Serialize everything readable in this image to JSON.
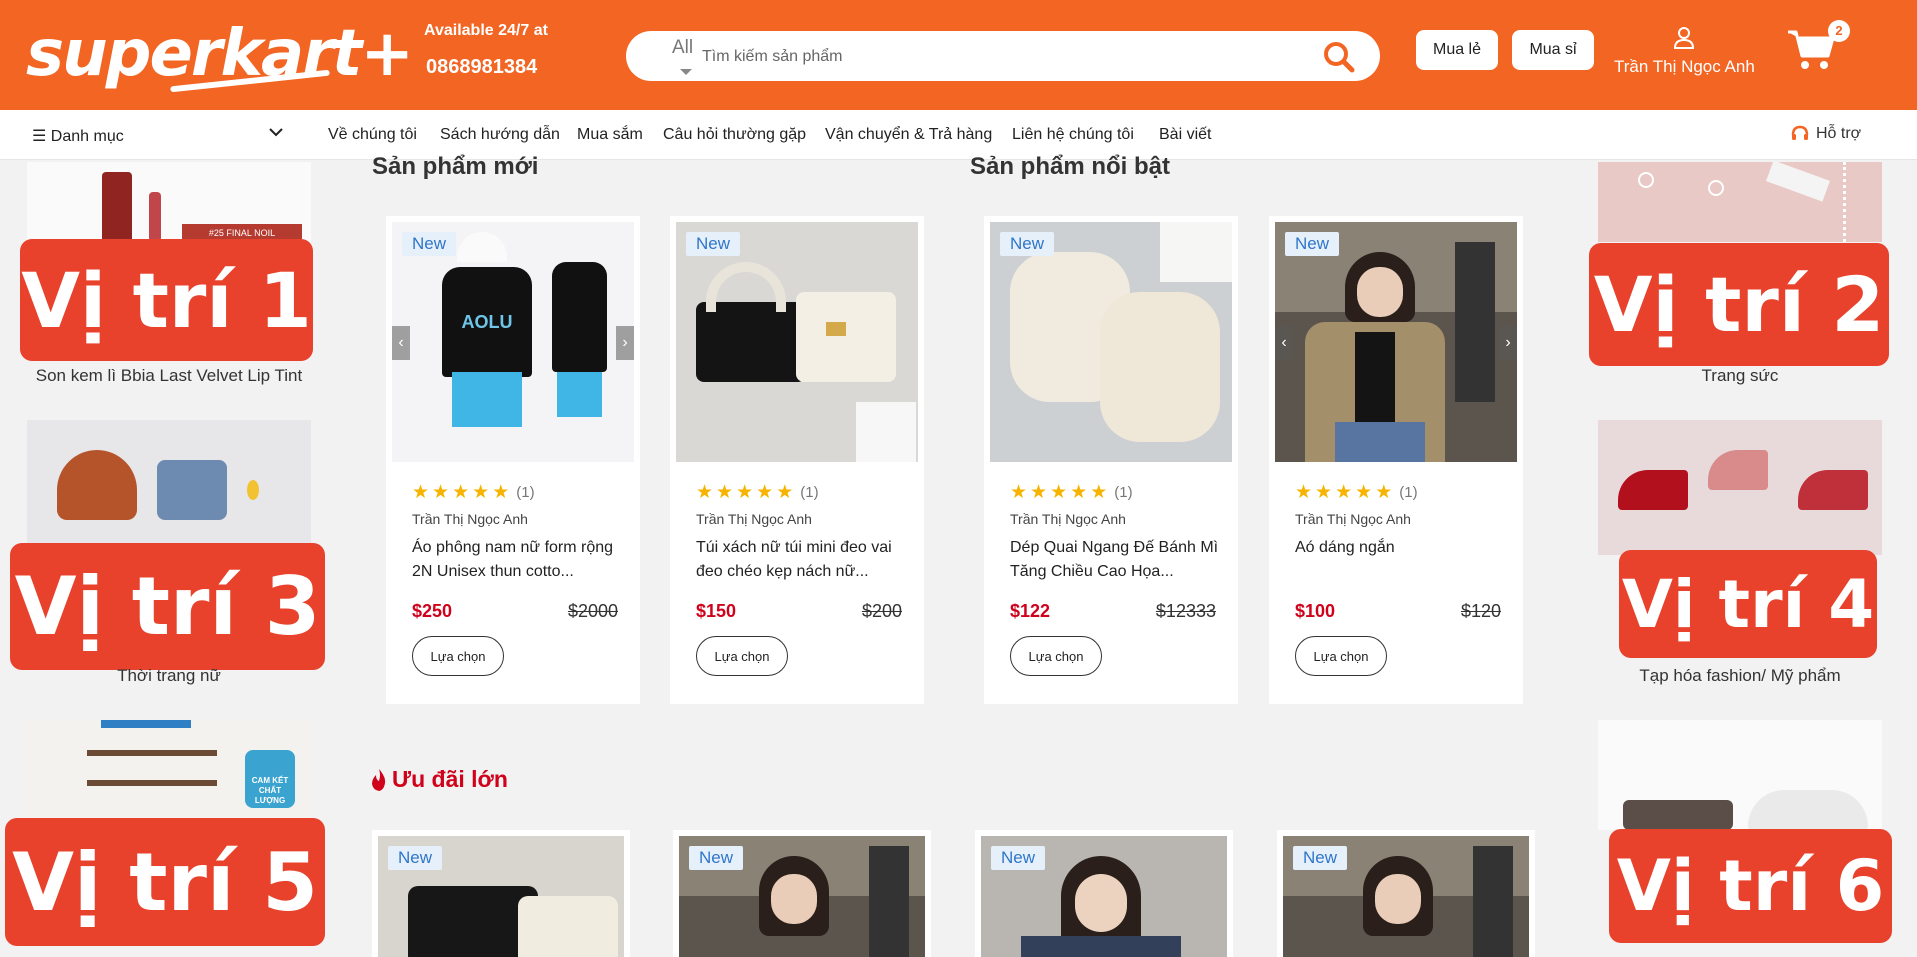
{
  "header": {
    "logo_text": "superkart+",
    "available_text": "Available 24/7 at",
    "phone": "0868981384",
    "search": {
      "category": "All",
      "placeholder": "Tìm kiếm sản phẩm"
    },
    "buttons": {
      "retail": "Mua lẻ",
      "wholesale": "Mua sỉ"
    },
    "user_name": "Trần Thị Ngọc Anh",
    "cart_count": "2"
  },
  "nav": {
    "category_label": "Danh mục",
    "items": [
      "Về chúng tôi",
      "Sách hướng dẫn",
      "Mua sắm",
      "Câu hỏi thường gặp",
      "Vận chuyển & Trả hàng",
      "Liên hệ chúng tôi",
      "Bài viết"
    ],
    "support": "Hỗ trợ"
  },
  "banners": [
    {
      "tag": "Vị trí 1",
      "label": "Son kem lì Bbia Last Velvet Lip Tint"
    },
    {
      "tag": "Vị trí 2",
      "label": "Trang sức"
    },
    {
      "tag": "Vị trí 3",
      "label": "Thời trang nữ"
    },
    {
      "tag": "Vị trí 4",
      "label": "Tạp hóa fashion/ Mỹ phẩm"
    },
    {
      "tag": "Vị trí 5",
      "label": ""
    },
    {
      "tag": "Vị trí 6",
      "label": ""
    }
  ],
  "banner_small_texts": {
    "lip_box": "#25 FINAL NOIL",
    "guarantee": "CAM KẾT CHẤT LƯỢNG"
  },
  "sections": {
    "new_title": "Sản phẩm mới",
    "featured_title": "Sản phẩm nổi bật",
    "deals_title": "Ưu đãi lớn"
  },
  "products": [
    {
      "badge": "New",
      "rating": "(1)",
      "seller": "Trần Thị Ngọc Anh",
      "name": "Áo phông nam nữ form rộng 2N Unisex thun cotto...",
      "price": "$250",
      "old_price": "$2000",
      "button": "Lựa chọn"
    },
    {
      "badge": "New",
      "rating": "(1)",
      "seller": "Trần Thị Ngọc Anh",
      "name": "Túi xách nữ túi mini đeo vai đeo chéo kẹp nách nữ...",
      "price": "$150",
      "old_price": "$200",
      "button": "Lựa chọn"
    },
    {
      "badge": "New",
      "rating": "(1)",
      "seller": "Trần Thị Ngọc Anh",
      "name": "Dép Quai Ngang Đế Bánh Mì Tăng Chiều Cao Họa...",
      "price": "$122",
      "old_price": "$12333",
      "button": "Lựa chọn"
    },
    {
      "badge": "New",
      "rating": "(1)",
      "seller": "Trần Thị Ngọc Anh",
      "name": "Aó dáng ngắn",
      "price": "$100",
      "old_price": "$120",
      "button": "Lựa chọn"
    }
  ],
  "deals": [
    {
      "badge": "New"
    },
    {
      "badge": "New"
    },
    {
      "badge": "New"
    },
    {
      "badge": "New"
    }
  ],
  "colors": {
    "brand": "#f26522",
    "tag_red": "#e8412c",
    "price_red": "#d0021b",
    "star": "#f6b400"
  }
}
